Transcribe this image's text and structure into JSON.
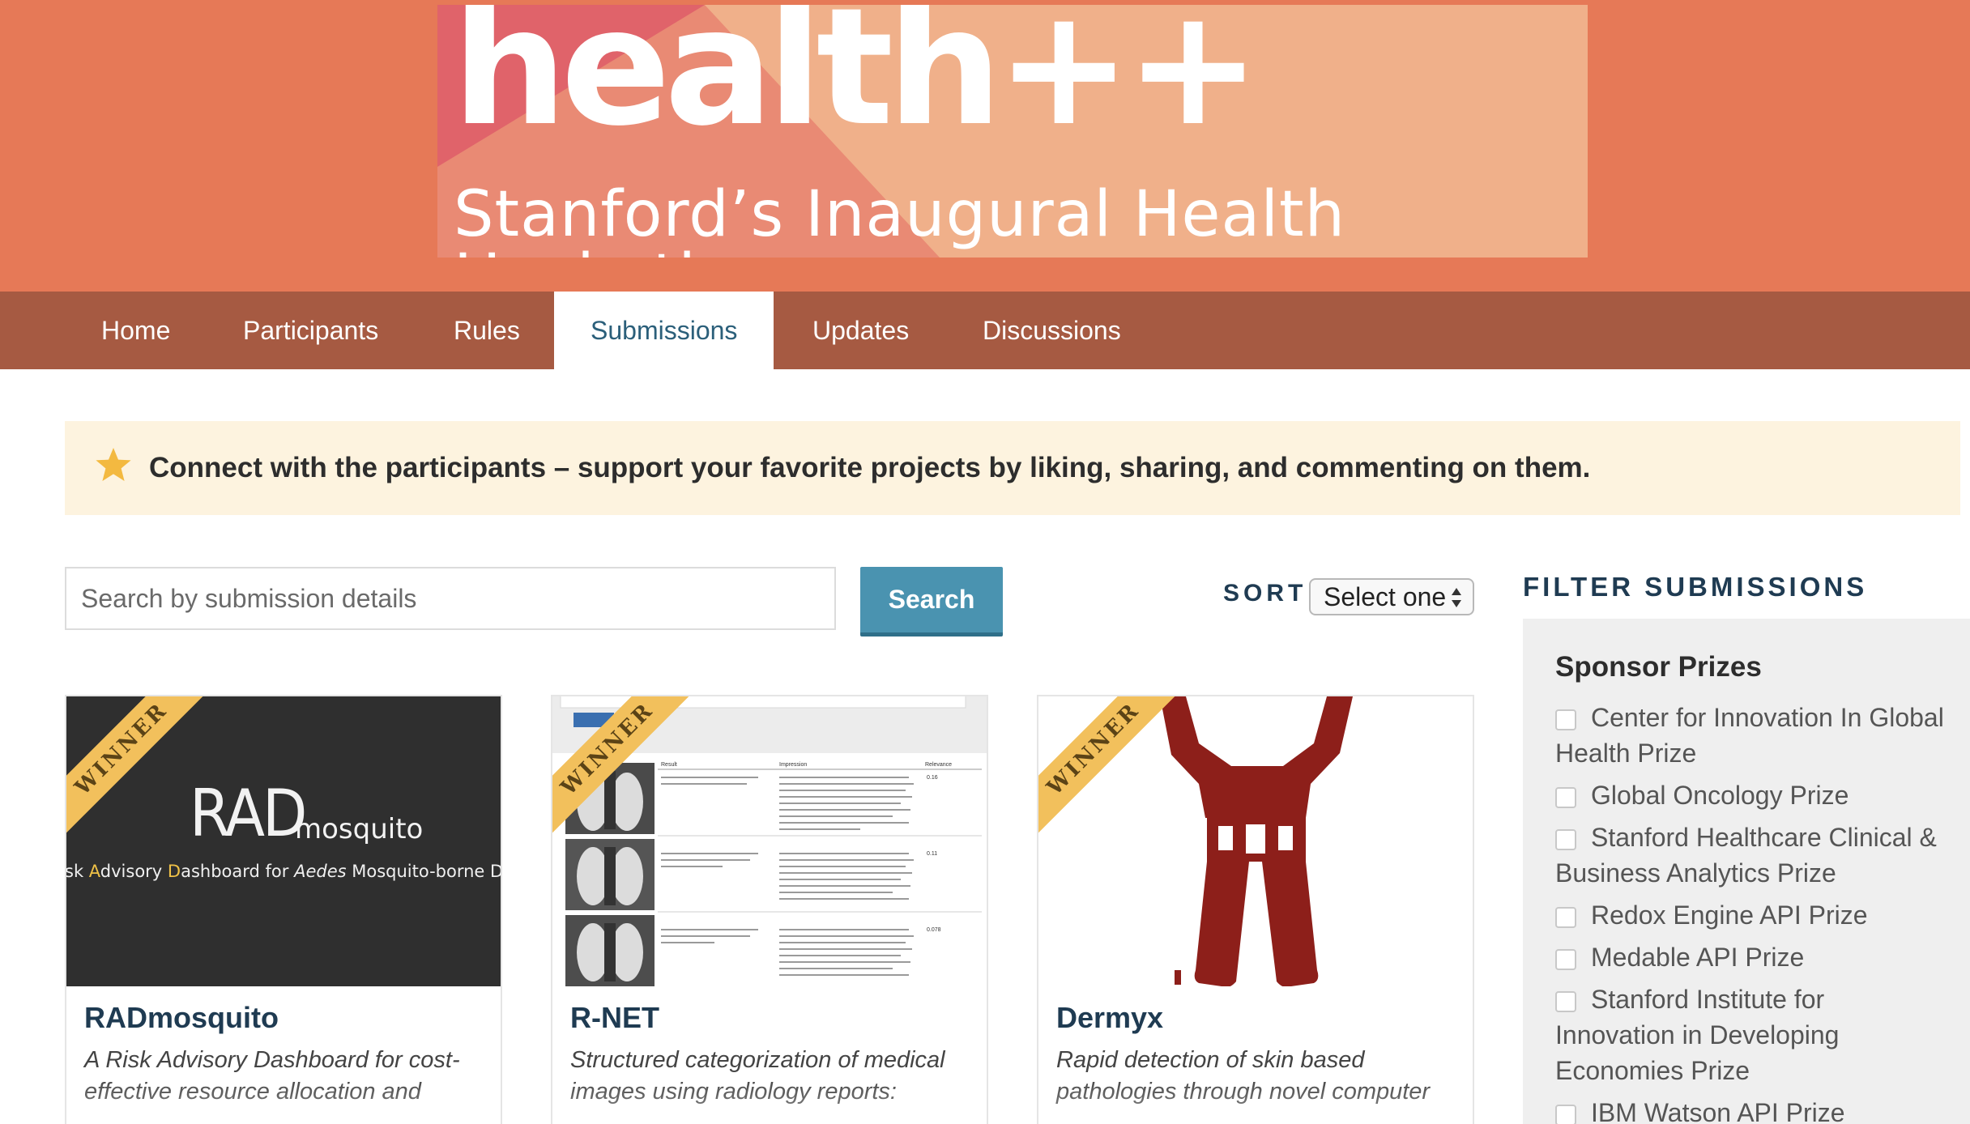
{
  "header": {
    "logo_title": "health++",
    "logo_subtitle": "Stanford’s Inaugural Health Hackathon"
  },
  "nav": {
    "items": [
      {
        "label": "Home",
        "active": false
      },
      {
        "label": "Participants",
        "active": false
      },
      {
        "label": "Rules",
        "active": false
      },
      {
        "label": "Submissions",
        "active": true
      },
      {
        "label": "Updates",
        "active": false
      },
      {
        "label": "Discussions",
        "active": false
      }
    ]
  },
  "notice": {
    "icon": "star-icon",
    "text": "Connect with the participants – support your favorite projects by liking, sharing, and commenting on them."
  },
  "search": {
    "placeholder": "Search by submission details",
    "value": "",
    "button_label": "Search"
  },
  "sort": {
    "label": "SORT",
    "selected": "Select one"
  },
  "submissions": [
    {
      "badge": "WINNER",
      "title": "RADmosquito",
      "description": "A Risk Advisory Dashboard for cost-effective resource allocation and",
      "thumb": {
        "logo_big": "RAD",
        "logo_small": "mosquito",
        "tagline_prefix": "sk ",
        "tagline_a": "A",
        "tagline_b": "dvisory ",
        "tagline_c": "D",
        "tagline_d": "ashboard for ",
        "tagline_e": "Aedes",
        "tagline_f": " Mosquito-borne Disease Resp"
      }
    },
    {
      "badge": "WINNER",
      "title": "R-NET",
      "description": "Structured categorization of medical images using radiology reports:",
      "thumb": {
        "col_result": "Result",
        "col_impression": "Impression",
        "col_relevance": "Relevance",
        "scores": [
          "0.16",
          "0.11",
          "0.078"
        ]
      }
    },
    {
      "badge": "WINNER",
      "title": "Dermyx",
      "description": "Rapid detection of skin based pathologies through novel computer",
      "thumb": {}
    }
  ],
  "filter": {
    "title": "FILTER SUBMISSIONS",
    "heading": "Sponsor Prizes",
    "items": [
      "Center for Innovation In Global Health Prize",
      "Global Oncology Prize",
      "Stanford Healthcare Clinical & Business Analytics Prize",
      "Redox Engine API Prize",
      "Medable API Prize",
      "Stanford Institute for Innovation in Developing Economies Prize",
      "IBM Watson API Prize"
    ]
  },
  "colors": {
    "header_bg": "#e67957",
    "nav_bg": "#a65a42",
    "nav_active_text": "#2b5f7a",
    "notice_bg": "#fdf3df",
    "search_button": "#4a93b0",
    "ribbon": "#f2c05c",
    "title_text": "#1f3b52"
  }
}
